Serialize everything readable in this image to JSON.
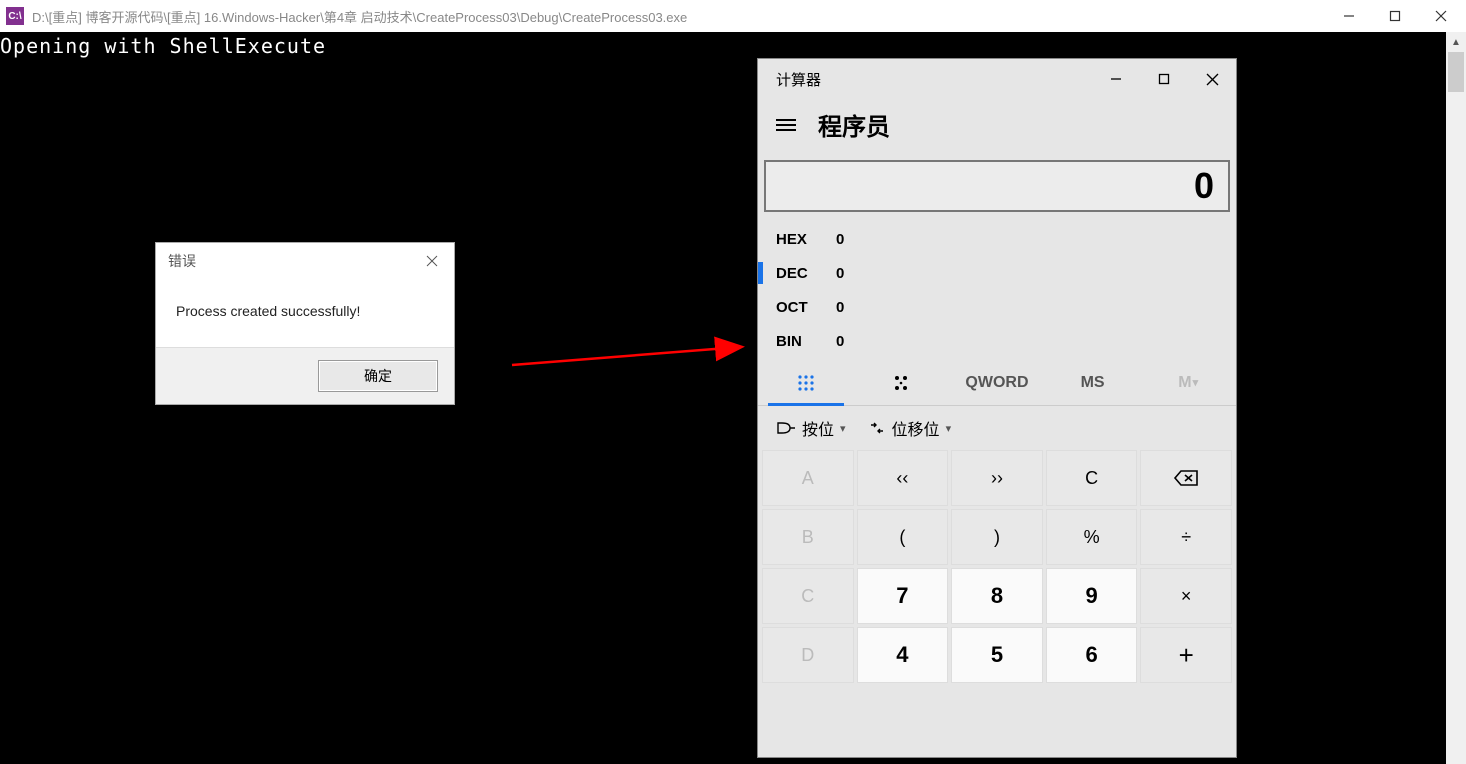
{
  "outer_window": {
    "icon_text": "C:\\",
    "title": "D:\\[重点] 博客开源代码\\[重点] 16.Windows-Hacker\\第4章 启动技术\\CreateProcess03\\Debug\\CreateProcess03.exe"
  },
  "console": {
    "line1": "Opening with ShellExecute"
  },
  "dialog": {
    "title": "错误",
    "message": "Process created successfully!",
    "ok_label": "确定"
  },
  "calc": {
    "title": "计算器",
    "mode": "程序员",
    "display": "0",
    "bases": [
      {
        "name": "HEX",
        "value": "0",
        "active": false
      },
      {
        "name": "DEC",
        "value": "0",
        "active": true
      },
      {
        "name": "OCT",
        "value": "0",
        "active": false
      },
      {
        "name": "BIN",
        "value": "0",
        "active": false
      }
    ],
    "tabs": {
      "qword": "QWORD",
      "ms": "MS",
      "m": "M"
    },
    "shift": {
      "bitwise": "按位",
      "bitshift": "位移位"
    },
    "keys": {
      "A": "A",
      "B": "B",
      "C_hex": "C",
      "D": "D",
      "lsh": "‹‹",
      "rsh": "››",
      "clear": "C",
      "back": "bksp",
      "open_paren": "(",
      "close_paren": ")",
      "percent": "%",
      "div": "÷",
      "n7": "7",
      "n8": "8",
      "n9": "9",
      "mul": "×",
      "n4": "4",
      "n5": "5",
      "n6": "6",
      "plus": "+"
    }
  }
}
